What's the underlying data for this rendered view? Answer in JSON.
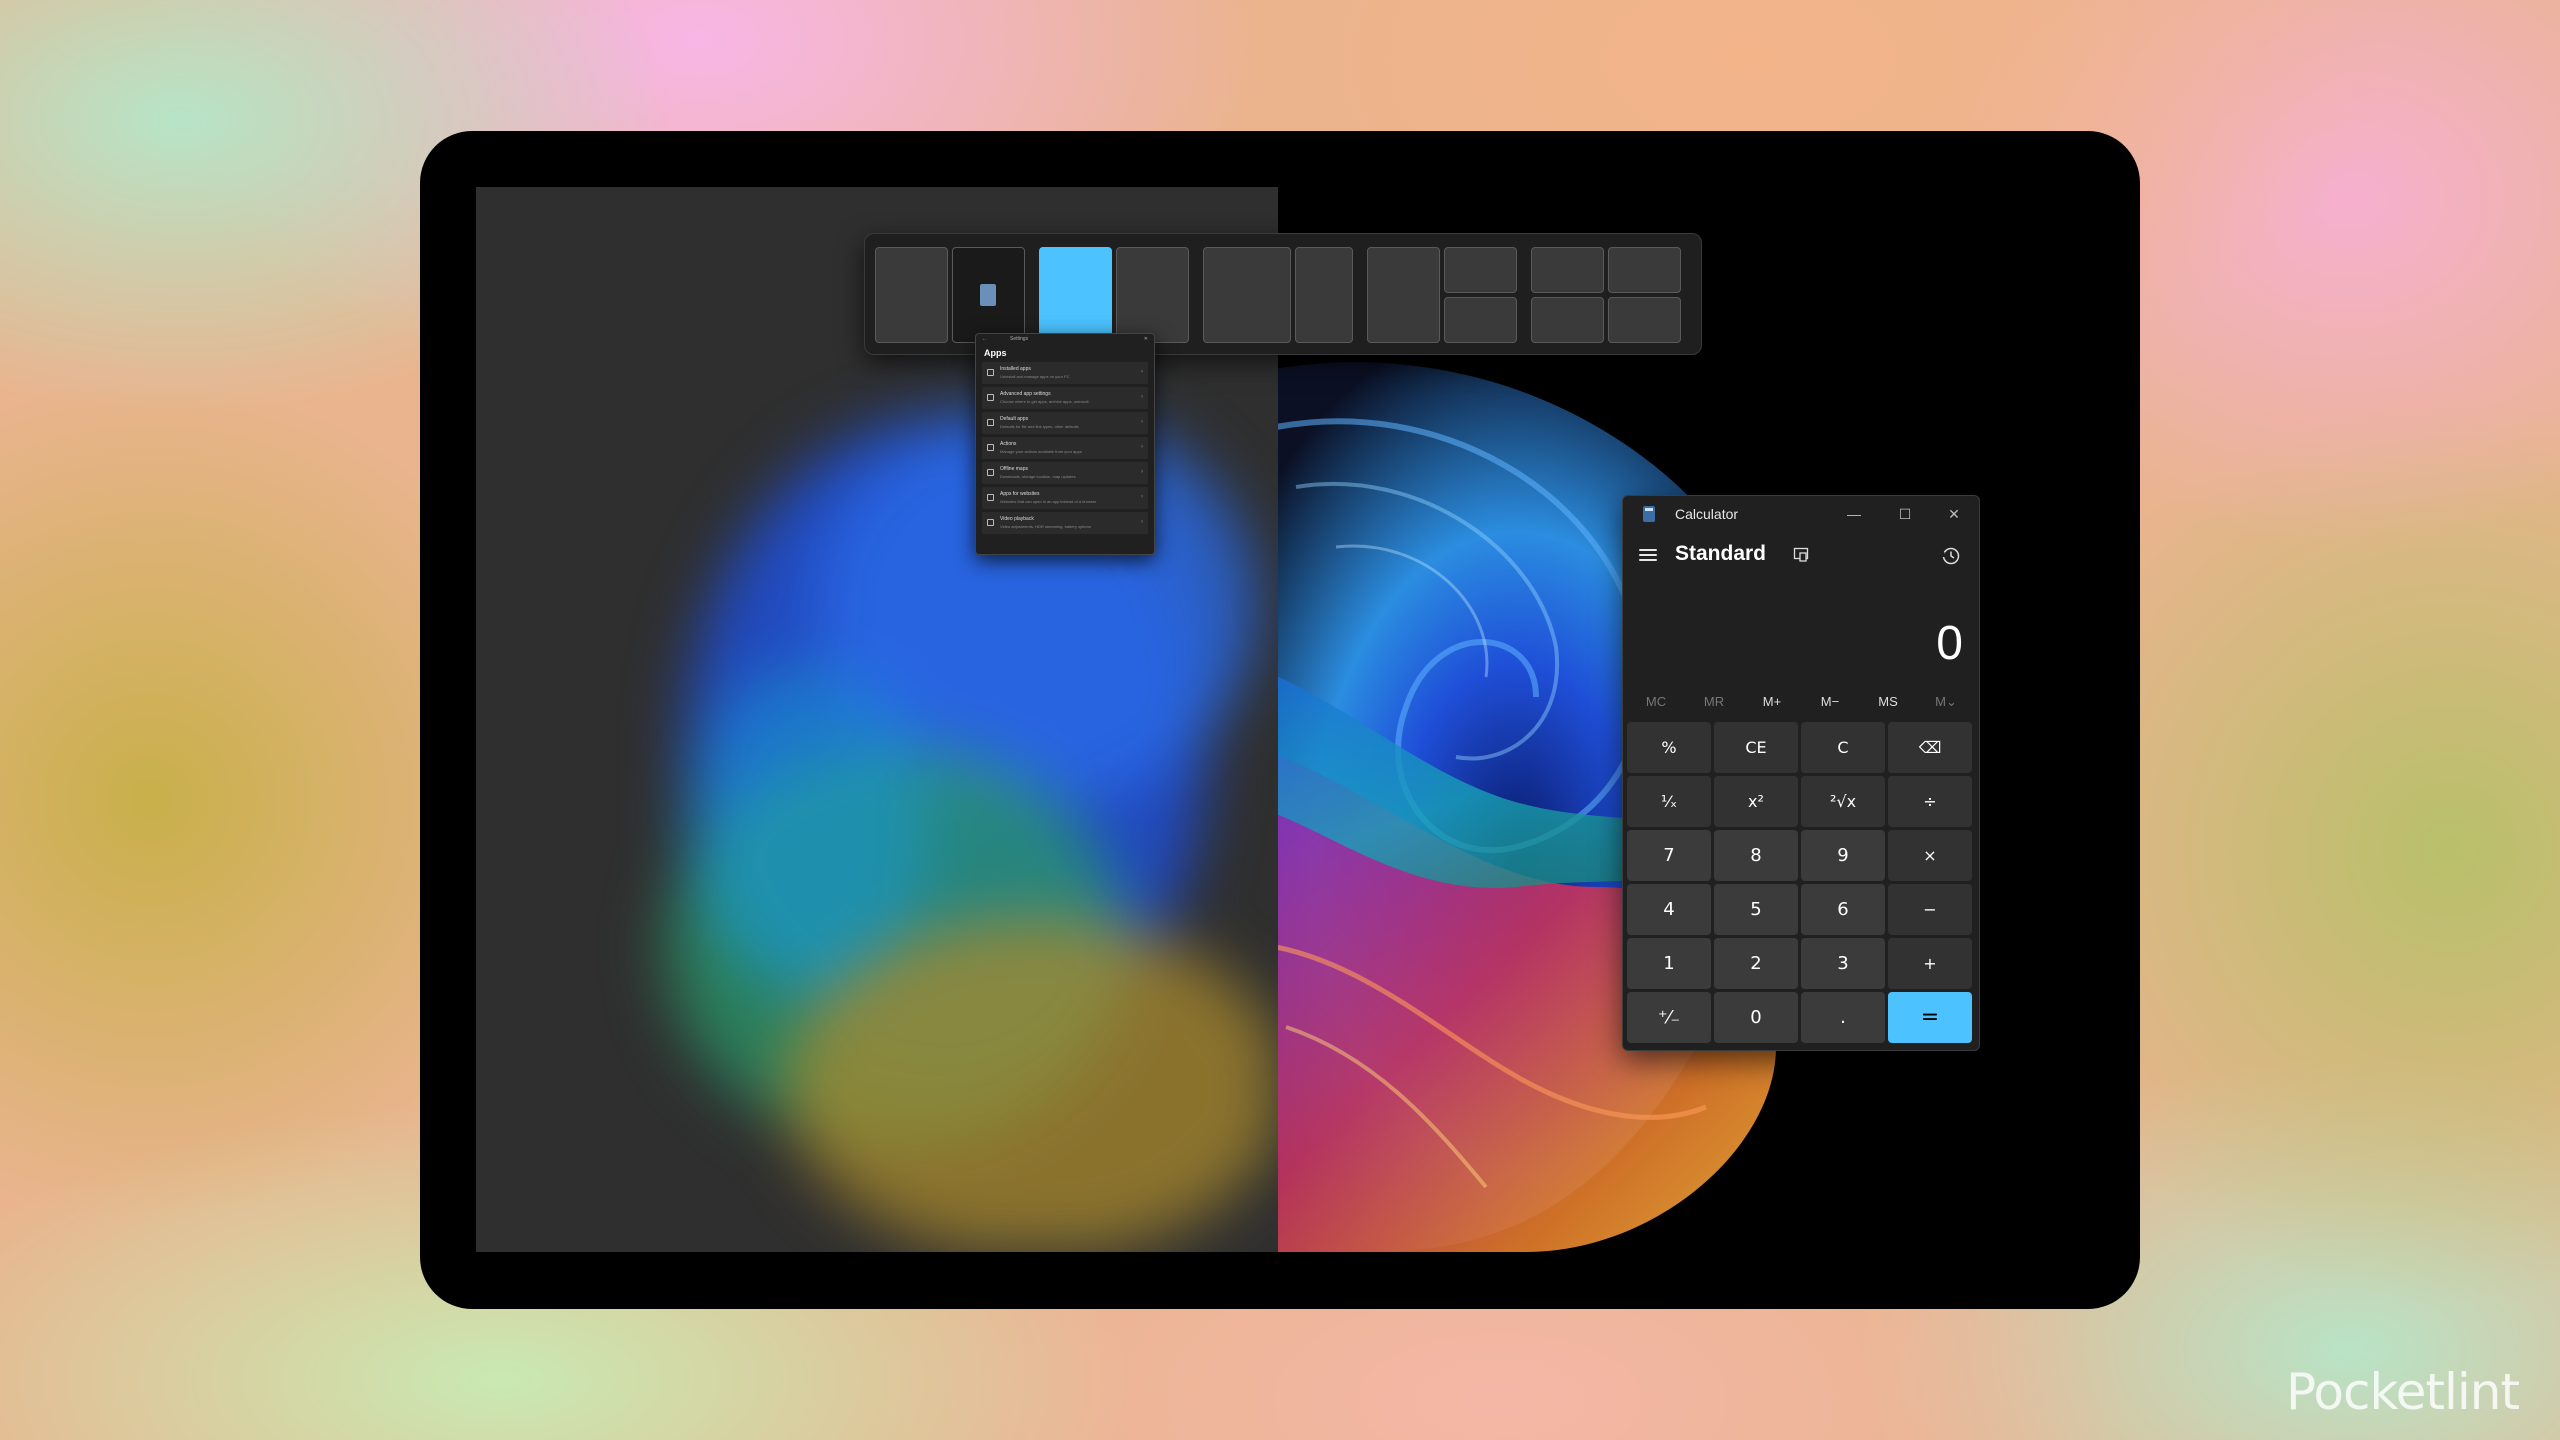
{
  "settings_window": {
    "title": "Settings",
    "heading": "Apps",
    "items": [
      {
        "title": "Installed apps",
        "subtitle": "Uninstall and manage apps on your PC"
      },
      {
        "title": "Advanced app settings",
        "subtitle": "Choose where to get apps, archive apps, uninstall"
      },
      {
        "title": "Default apps",
        "subtitle": "Defaults for file and link types, other defaults"
      },
      {
        "title": "Actions",
        "subtitle": "Manage your actions available from your apps"
      },
      {
        "title": "Offline maps",
        "subtitle": "Downloads, storage location, map updates"
      },
      {
        "title": "Apps for websites",
        "subtitle": "Websites that can open in an app instead of a browser"
      },
      {
        "title": "Video playback",
        "subtitle": "Video adjustments, HDR streaming, battery options"
      }
    ]
  },
  "calculator": {
    "title": "Calculator",
    "mode": "Standard",
    "display": "0",
    "window_buttons": {
      "minimize": "—",
      "maximize": "☐",
      "close": "✕"
    },
    "memory": [
      "MC",
      "MR",
      "M+",
      "M−",
      "MS",
      "M⌄"
    ],
    "keys": [
      [
        "%",
        "CE",
        "C",
        "⌫"
      ],
      [
        "¹⁄ₓ",
        "x²",
        "²√x",
        "÷"
      ],
      [
        "7",
        "8",
        "9",
        "×"
      ],
      [
        "4",
        "5",
        "6",
        "−"
      ],
      [
        "1",
        "2",
        "3",
        "+"
      ],
      [
        "⁺⁄₋",
        "0",
        ".",
        "="
      ]
    ]
  },
  "watermark": "Pocketlint",
  "colors": {
    "accent": "#4cc2ff",
    "window_bg": "#202020",
    "snap_window": "#2f2f2f"
  }
}
